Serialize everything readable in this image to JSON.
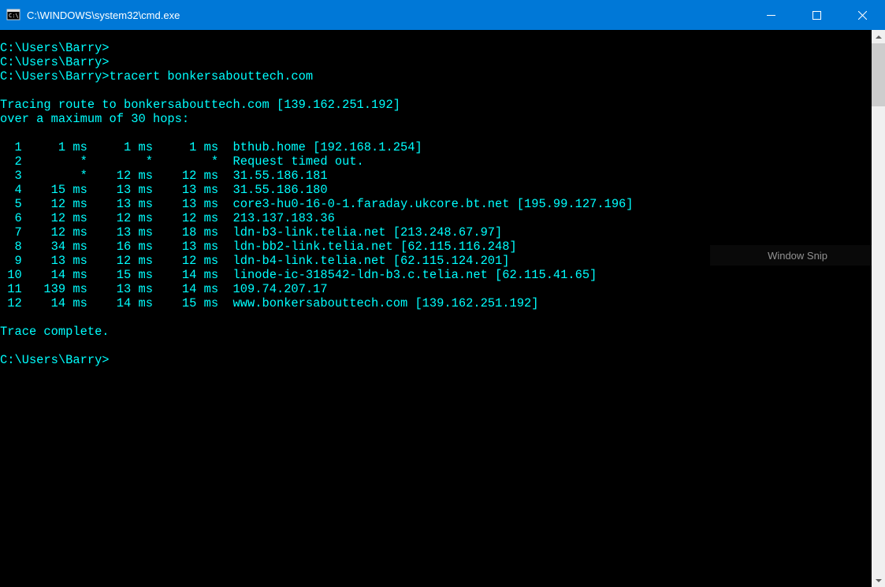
{
  "window": {
    "title": "C:\\WINDOWS\\system32\\cmd.exe"
  },
  "terminal": {
    "prompts": [
      "C:\\Users\\Barry>",
      "C:\\Users\\Barry>",
      "C:\\Users\\Barry>"
    ],
    "command": "tracert bonkersabouttech.com",
    "trace_header1": "Tracing route to bonkersabouttech.com [139.162.251.192]",
    "trace_header2": "over a maximum of 30 hops:",
    "hops": [
      {
        "n": 1,
        "t1": "1 ms",
        "t2": "1 ms",
        "t3": "1 ms",
        "host": "bthub.home [192.168.1.254]"
      },
      {
        "n": 2,
        "t1": "*",
        "t2": "*",
        "t3": "*",
        "host": "Request timed out."
      },
      {
        "n": 3,
        "t1": "*",
        "t2": "12 ms",
        "t3": "12 ms",
        "host": "31.55.186.181"
      },
      {
        "n": 4,
        "t1": "15 ms",
        "t2": "13 ms",
        "t3": "13 ms",
        "host": "31.55.186.180"
      },
      {
        "n": 5,
        "t1": "12 ms",
        "t2": "13 ms",
        "t3": "13 ms",
        "host": "core3-hu0-16-0-1.faraday.ukcore.bt.net [195.99.127.196]"
      },
      {
        "n": 6,
        "t1": "12 ms",
        "t2": "12 ms",
        "t3": "12 ms",
        "host": "213.137.183.36"
      },
      {
        "n": 7,
        "t1": "12 ms",
        "t2": "13 ms",
        "t3": "18 ms",
        "host": "ldn-b3-link.telia.net [213.248.67.97]"
      },
      {
        "n": 8,
        "t1": "34 ms",
        "t2": "16 ms",
        "t3": "13 ms",
        "host": "ldn-bb2-link.telia.net [62.115.116.248]"
      },
      {
        "n": 9,
        "t1": "13 ms",
        "t2": "12 ms",
        "t3": "12 ms",
        "host": "ldn-b4-link.telia.net [62.115.124.201]"
      },
      {
        "n": 10,
        "t1": "14 ms",
        "t2": "15 ms",
        "t3": "14 ms",
        "host": "linode-ic-318542-ldn-b3.c.telia.net [62.115.41.65]"
      },
      {
        "n": 11,
        "t1": "139 ms",
        "t2": "13 ms",
        "t3": "14 ms",
        "host": "109.74.207.17"
      },
      {
        "n": 12,
        "t1": "14 ms",
        "t2": "14 ms",
        "t3": "15 ms",
        "host": "www.bonkersabouttech.com [139.162.251.192]"
      }
    ],
    "trace_complete": "Trace complete.",
    "final_prompt": "C:\\Users\\Barry>"
  },
  "overlay": {
    "snip_label": "Window Snip"
  }
}
